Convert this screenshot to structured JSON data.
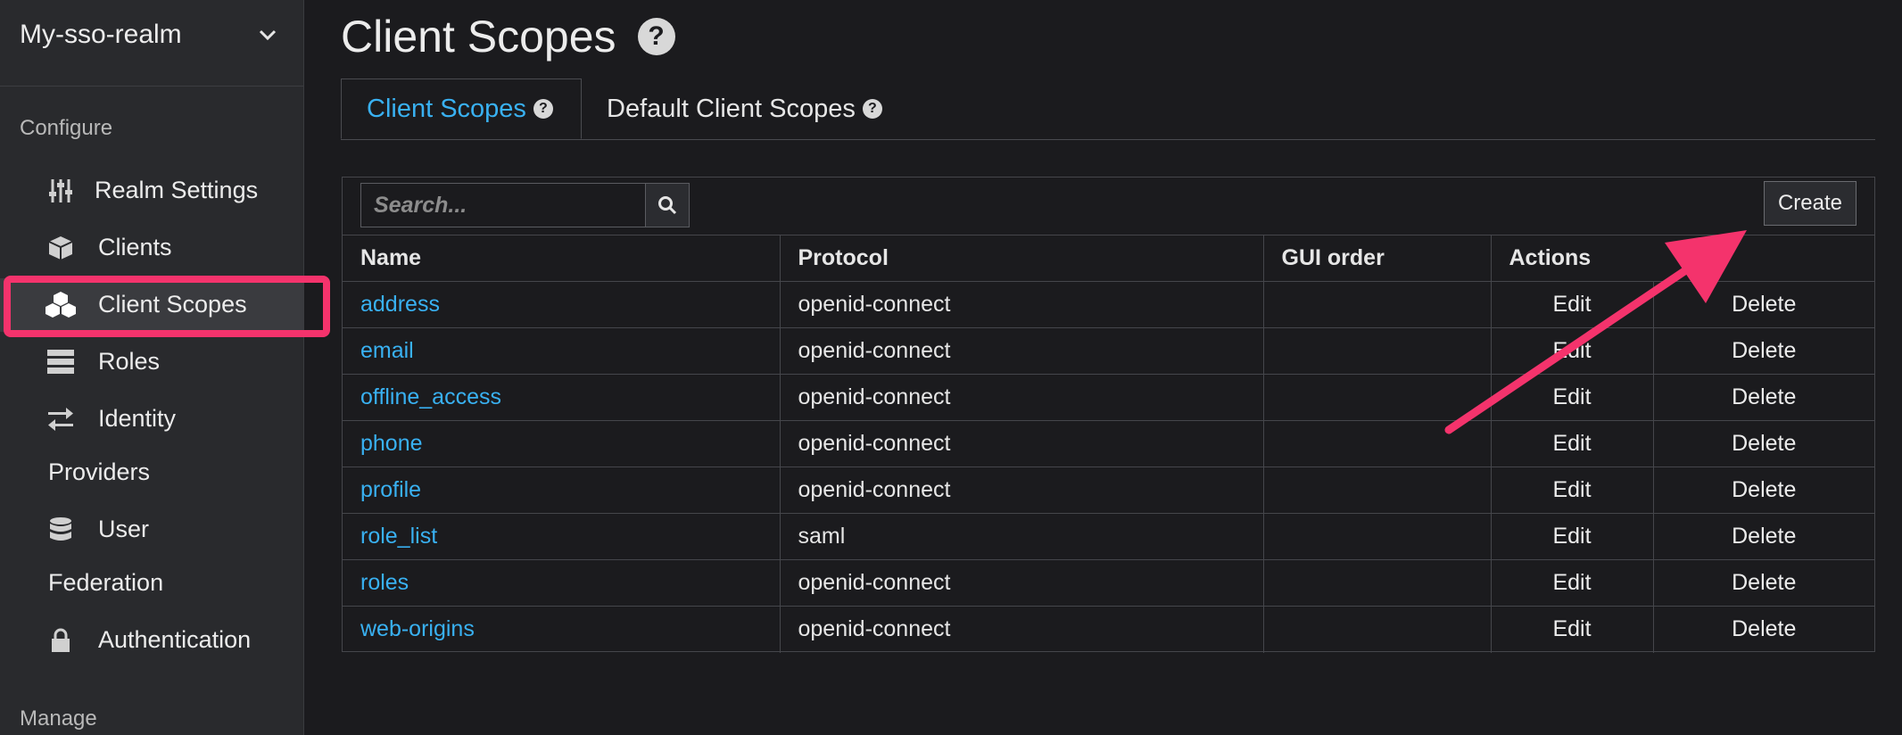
{
  "realm": {
    "name": "My-sso-realm"
  },
  "sidebar": {
    "configure_label": "Configure",
    "manage_label": "Manage",
    "items": [
      {
        "label": "Realm Settings",
        "icon": "sliders-icon"
      },
      {
        "label": "Clients",
        "icon": "cube-icon"
      },
      {
        "label": "Client Scopes",
        "icon": "cubes-icon"
      },
      {
        "label": "Roles",
        "icon": "server-icon"
      },
      {
        "label": "Identity",
        "label2": "Providers",
        "icon": "exchange-icon"
      },
      {
        "label": "User",
        "label2": "Federation",
        "icon": "database-icon"
      },
      {
        "label": "Authentication",
        "icon": "lock-icon"
      }
    ]
  },
  "page": {
    "title": "Client Scopes"
  },
  "tabs": [
    {
      "label": "Client Scopes"
    },
    {
      "label": "Default Client Scopes"
    }
  ],
  "toolbar": {
    "search_placeholder": "Search...",
    "create_label": "Create"
  },
  "table": {
    "headers": [
      "Name",
      "Protocol",
      "GUI order",
      "Actions"
    ],
    "rows": [
      {
        "name": "address",
        "protocol": "openid-connect",
        "gui_order": "",
        "edit": "Edit",
        "delete": "Delete"
      },
      {
        "name": "email",
        "protocol": "openid-connect",
        "gui_order": "",
        "edit": "Edit",
        "delete": "Delete"
      },
      {
        "name": "offline_access",
        "protocol": "openid-connect",
        "gui_order": "",
        "edit": "Edit",
        "delete": "Delete"
      },
      {
        "name": "phone",
        "protocol": "openid-connect",
        "gui_order": "",
        "edit": "Edit",
        "delete": "Delete"
      },
      {
        "name": "profile",
        "protocol": "openid-connect",
        "gui_order": "",
        "edit": "Edit",
        "delete": "Delete"
      },
      {
        "name": "role_list",
        "protocol": "saml",
        "gui_order": "",
        "edit": "Edit",
        "delete": "Delete"
      },
      {
        "name": "roles",
        "protocol": "openid-connect",
        "gui_order": "",
        "edit": "Edit",
        "delete": "Delete"
      },
      {
        "name": "web-origins",
        "protocol": "openid-connect",
        "gui_order": "",
        "edit": "Edit",
        "delete": "Delete"
      }
    ]
  },
  "colors": {
    "accent": "#39b1f2",
    "annotation": "#f4336c"
  }
}
